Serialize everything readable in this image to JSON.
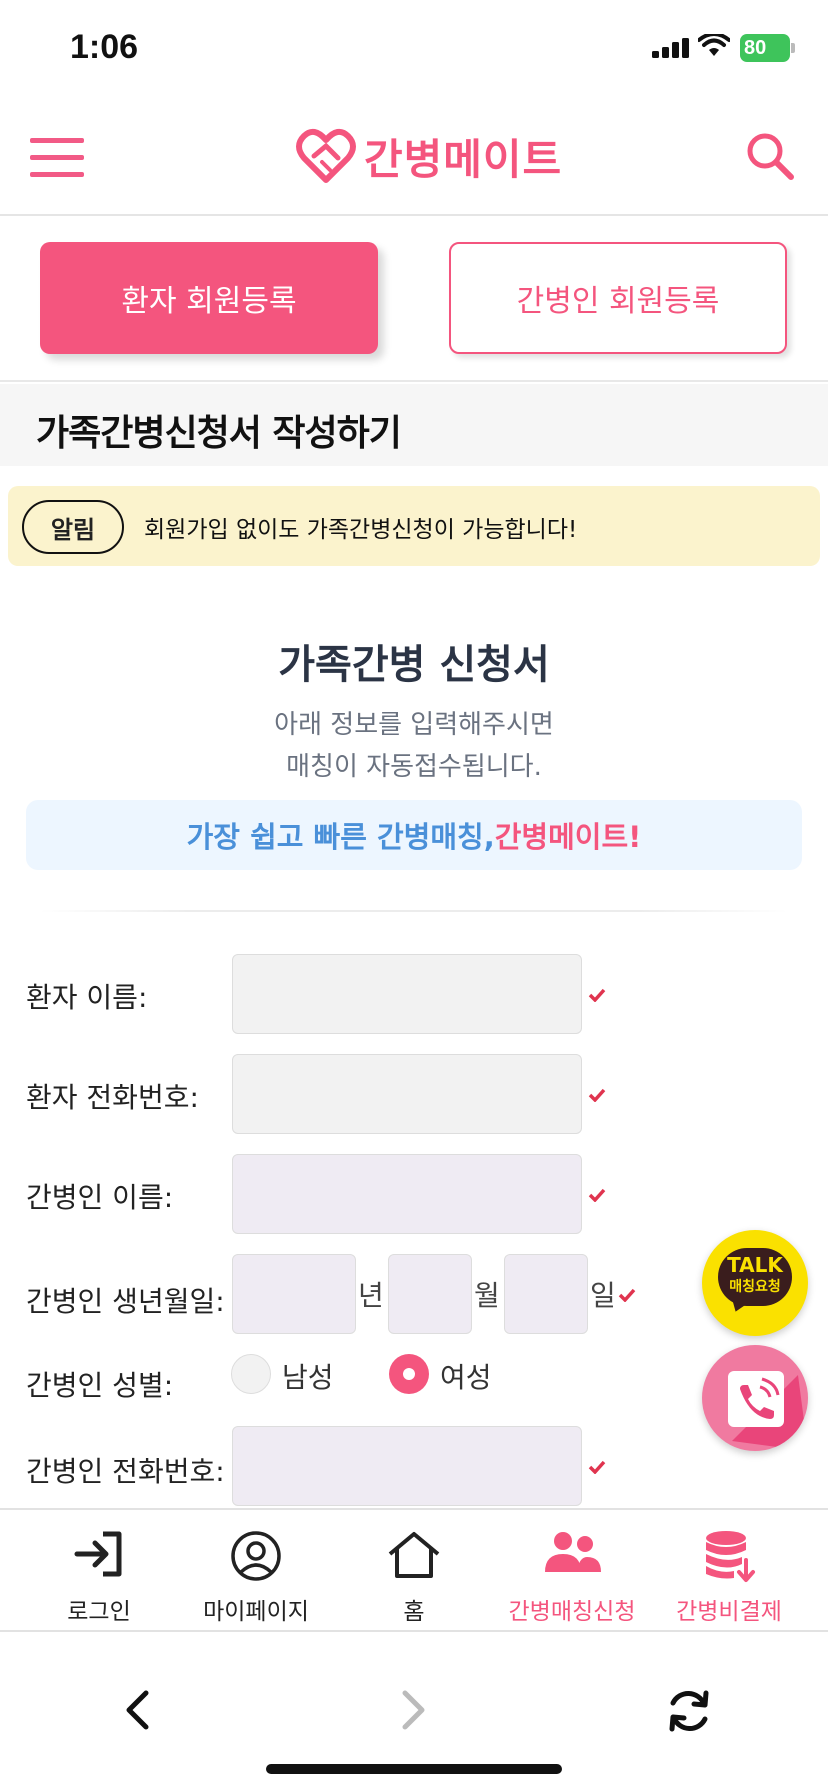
{
  "status_bar": {
    "time": "1:06",
    "battery": "80"
  },
  "header": {
    "logo_text": "간병메이트"
  },
  "registration": {
    "patient_button": "환자 회원등록",
    "caregiver_button": "간병인 회원등록"
  },
  "page_title": "가족간병신청서 작성하기",
  "notice": {
    "badge": "알림",
    "text": "회원가입 없이도 가족간병신청이 가능합니다!"
  },
  "form": {
    "title": "가족간병 신청서",
    "desc_line1": "아래 정보를 입력해주시면",
    "desc_line2": "매칭이 자동접수됩니다.",
    "banner_part1": "가장 쉽고 빠른 간병매칭, ",
    "banner_part2": "간병메이트!",
    "fields": {
      "patient_name": "환자 이름:",
      "patient_phone": "환자 전화번호:",
      "caregiver_name": "간병인 이름:",
      "caregiver_birth": "간병인 생년월일:",
      "caregiver_gender": "간병인 성별:",
      "caregiver_phone": "간병인 전화번호:"
    },
    "birth_units": {
      "year": "년",
      "month": "월",
      "day": "일"
    },
    "gender_options": {
      "male": "남성",
      "female": "여성",
      "selected": "여성"
    }
  },
  "floating": {
    "talk_line1": "TALK",
    "talk_line2": "매칭요청"
  },
  "bottom_nav": [
    {
      "label": "로그인",
      "icon": "login-icon"
    },
    {
      "label": "마이페이지",
      "icon": "user-circle-icon"
    },
    {
      "label": "홈",
      "icon": "home-icon"
    },
    {
      "label": "간병매칭신청",
      "icon": "users-icon"
    },
    {
      "label": "간병비결제",
      "icon": "database-download-icon"
    }
  ],
  "colors": {
    "brand": "#f4557e",
    "banner_blue": "#4a90d9",
    "notice_bg": "#fbf3cd",
    "kakao": "#fae100"
  }
}
